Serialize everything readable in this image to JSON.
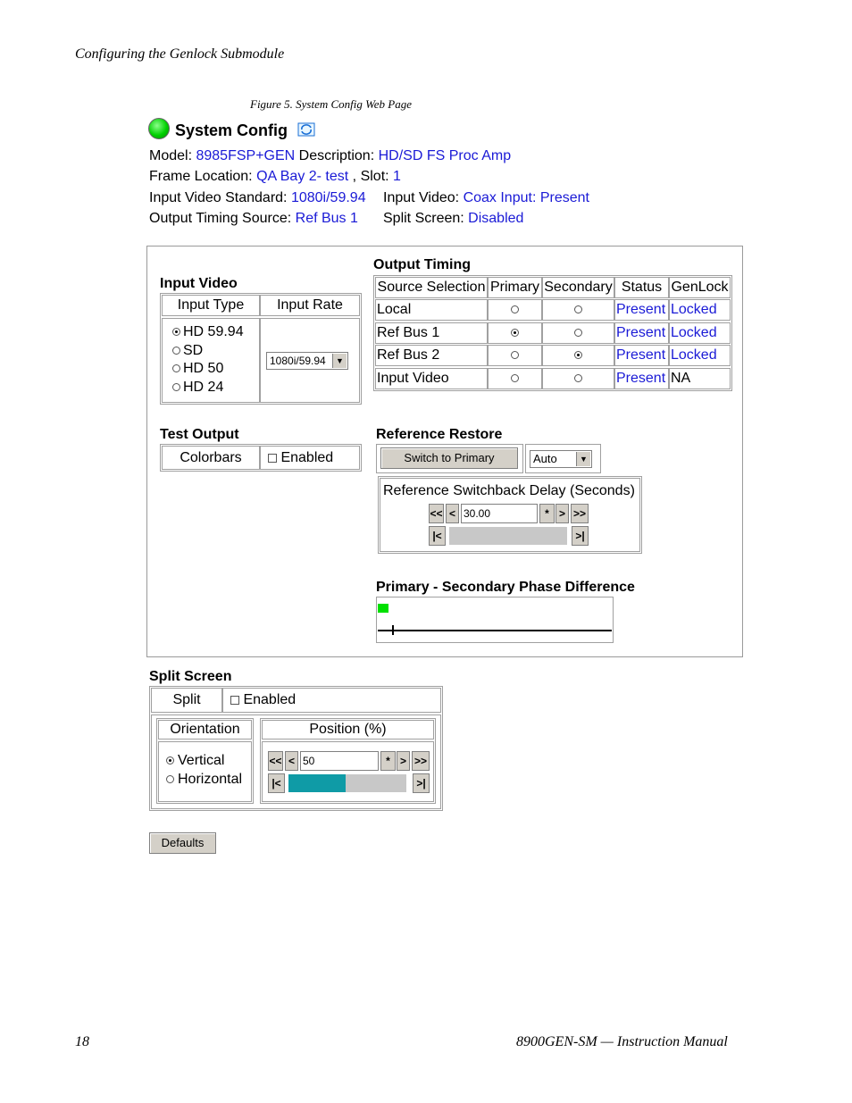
{
  "header": {
    "running_title": "Configuring the Genlock Submodule",
    "figure_caption": "Figure 5.  System Config Web Page"
  },
  "page_title": "System Config",
  "info": {
    "model_label": "Model:",
    "model_value": "8985FSP+GEN",
    "description_label": "Description:",
    "description_value": "HD/SD FS Proc Amp",
    "frame_label": "Frame Location:",
    "frame_value": "QA Bay 2- test",
    "slot_label": ", Slot:",
    "slot_value": "1",
    "ivs_label": "Input Video Standard:",
    "ivs_value": "1080i/59.94",
    "iv_label": "Input Video:",
    "iv_value1": "Coax Input",
    "iv_sep": ":",
    "iv_value2": "Present",
    "ots_label": "Output Timing Source:",
    "ots_value": "Ref Bus 1",
    "split_label": "Split Screen:",
    "split_value": "Disabled"
  },
  "input_video": {
    "title": "Input Video",
    "col_type": "Input Type",
    "col_rate": "Input Rate",
    "options": [
      {
        "label": "HD 59.94",
        "selected": true
      },
      {
        "label": "SD",
        "selected": false
      },
      {
        "label": "HD 50",
        "selected": false
      },
      {
        "label": "HD 24",
        "selected": false
      }
    ],
    "rate_value": "1080i/59.94"
  },
  "output_timing": {
    "title": "Output Timing",
    "headers": [
      "Source Selection",
      "Primary",
      "Secondary",
      "Status",
      "GenLock"
    ],
    "rows": [
      {
        "source": "Local",
        "primary": false,
        "secondary": false,
        "status": "Present",
        "genlock": "Locked"
      },
      {
        "source": "Ref Bus 1",
        "primary": true,
        "secondary": false,
        "status": "Present",
        "genlock": "Locked"
      },
      {
        "source": "Ref Bus 2",
        "primary": false,
        "secondary": true,
        "status": "Present",
        "genlock": "Locked"
      },
      {
        "source": "Input Video",
        "primary": false,
        "secondary": false,
        "status": "Present",
        "genlock": "NA"
      }
    ]
  },
  "test_output": {
    "title": "Test Output",
    "label": "Colorbars",
    "enabled_label": "Enabled"
  },
  "reference_restore": {
    "title": "Reference Restore",
    "switch_button": "Switch to Primary",
    "mode_value": "Auto",
    "delay_label": "Reference Switchback Delay (Seconds)",
    "delay_value": "30.00",
    "delay_fraction": 0.0
  },
  "phase": {
    "title": "Primary - Secondary Phase Difference"
  },
  "split_screen": {
    "title": "Split Screen",
    "split_label": "Split",
    "enabled_label": "Enabled",
    "orientation_label": "Orientation",
    "position_label": "Position (%)",
    "orientations": [
      {
        "label": "Vertical",
        "selected": true
      },
      {
        "label": "Horizontal",
        "selected": false
      }
    ],
    "position_value": "50",
    "position_fraction": 0.5
  },
  "defaults_button": "Defaults",
  "footer": {
    "page_number": "18",
    "manual_title": "8900GEN-SM — Instruction Manual"
  },
  "controls": {
    "fast_rew": "<<",
    "rew": "<",
    "mark": "*",
    "fwd": ">",
    "fast_fwd": ">>",
    "to_start": "|<",
    "to_end": ">|"
  },
  "colors": {
    "link": "#1a1ad6",
    "status_green": "#00e000",
    "slider_teal": "#0f9ba6",
    "panel_border": "#a0a0a0"
  }
}
